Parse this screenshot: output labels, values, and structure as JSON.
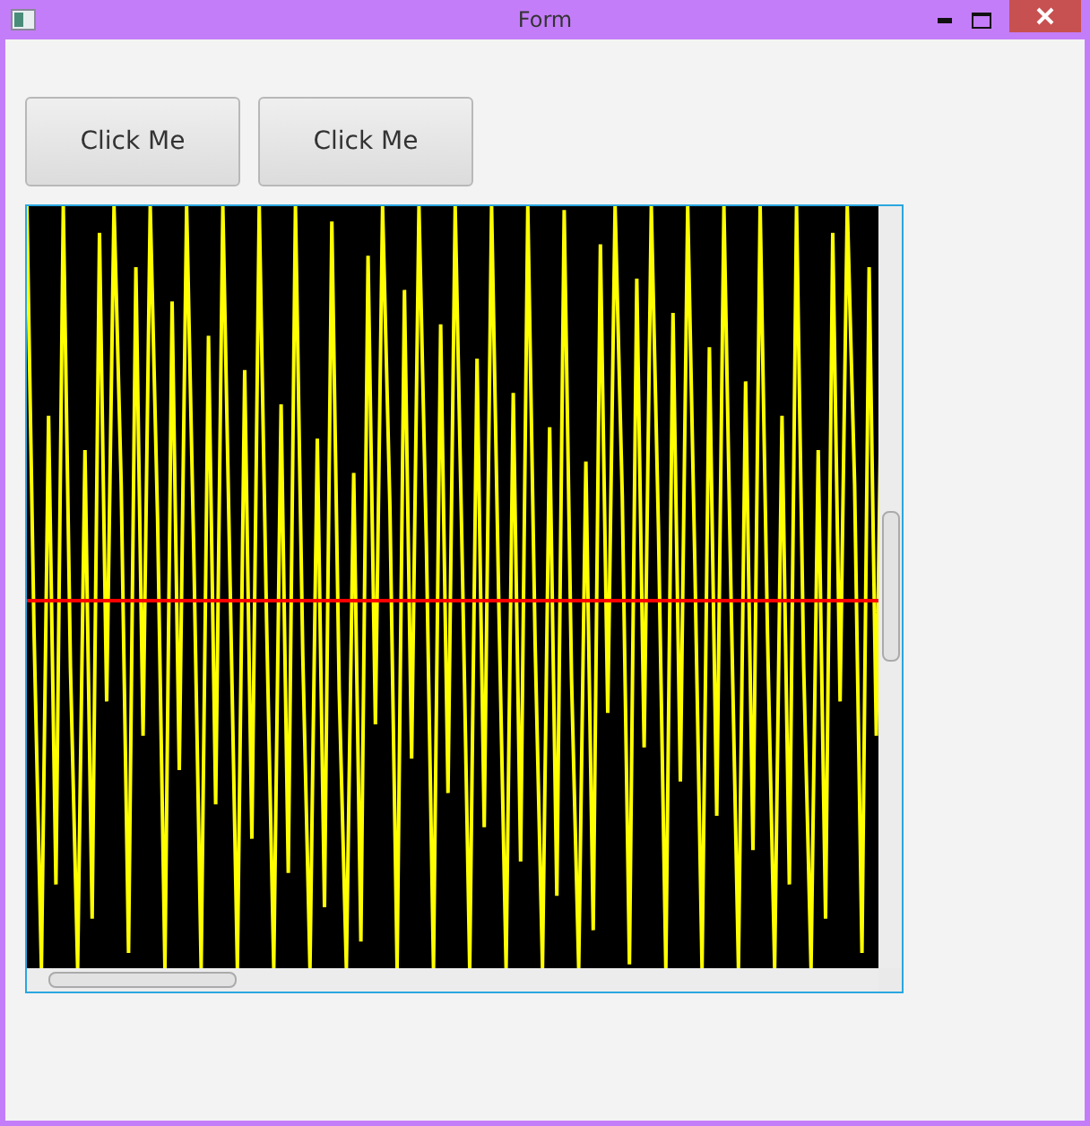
{
  "window": {
    "title": "Form"
  },
  "buttons": [
    {
      "label": "Click Me"
    },
    {
      "label": "Click Me"
    }
  ]
}
